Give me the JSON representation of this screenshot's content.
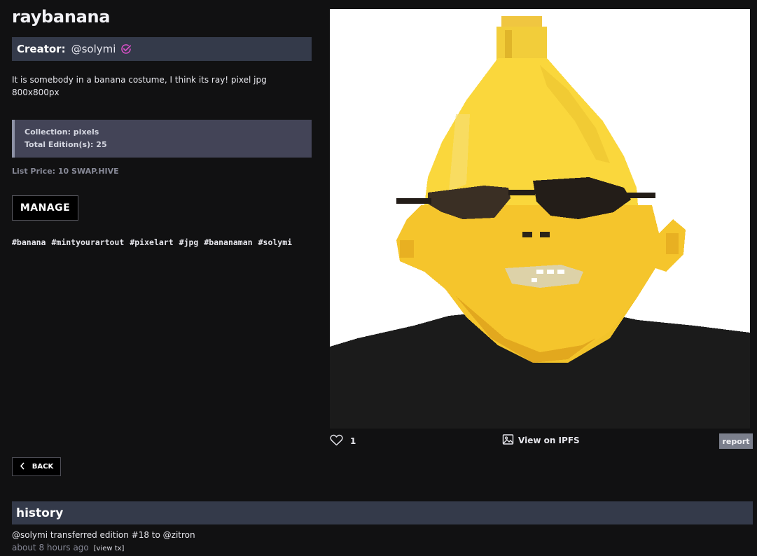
{
  "nft": {
    "title": "raybanana",
    "creator_label": "Creator:",
    "creator_user": "@solymi",
    "description": "It is somebody in a banana costume, I think its ray! pixel jpg 800x800px",
    "collection": "Collection: pixels",
    "editions": "Total Edition(s): 25",
    "list_price": "List Price: 10 SWAP.HIVE",
    "manage_label": "MANAGE",
    "tags": [
      "#banana",
      "#mintyourartout",
      "#pixelart",
      "#jpg",
      "#bananaman",
      "#solymi"
    ]
  },
  "actions": {
    "like_count": "1",
    "ipfs_label": "View on IPFS",
    "report_label": "report",
    "back_label": "BACK"
  },
  "history": {
    "title": "history",
    "entries": [
      {
        "text": "@solymi transferred edition #18 to @zitron",
        "time": "about 8 hours ago",
        "tx_label": "[view tx]"
      }
    ]
  },
  "icons": {
    "verified": "verified-check-icon",
    "like": "heart-icon",
    "ipfs": "image-icon",
    "back": "chevron-left-icon"
  },
  "colors": {
    "background": "#111112",
    "bar": "#343a4a",
    "collection_box": "#434457",
    "verified": "#d44fc4",
    "report": "#7b7f8c"
  }
}
